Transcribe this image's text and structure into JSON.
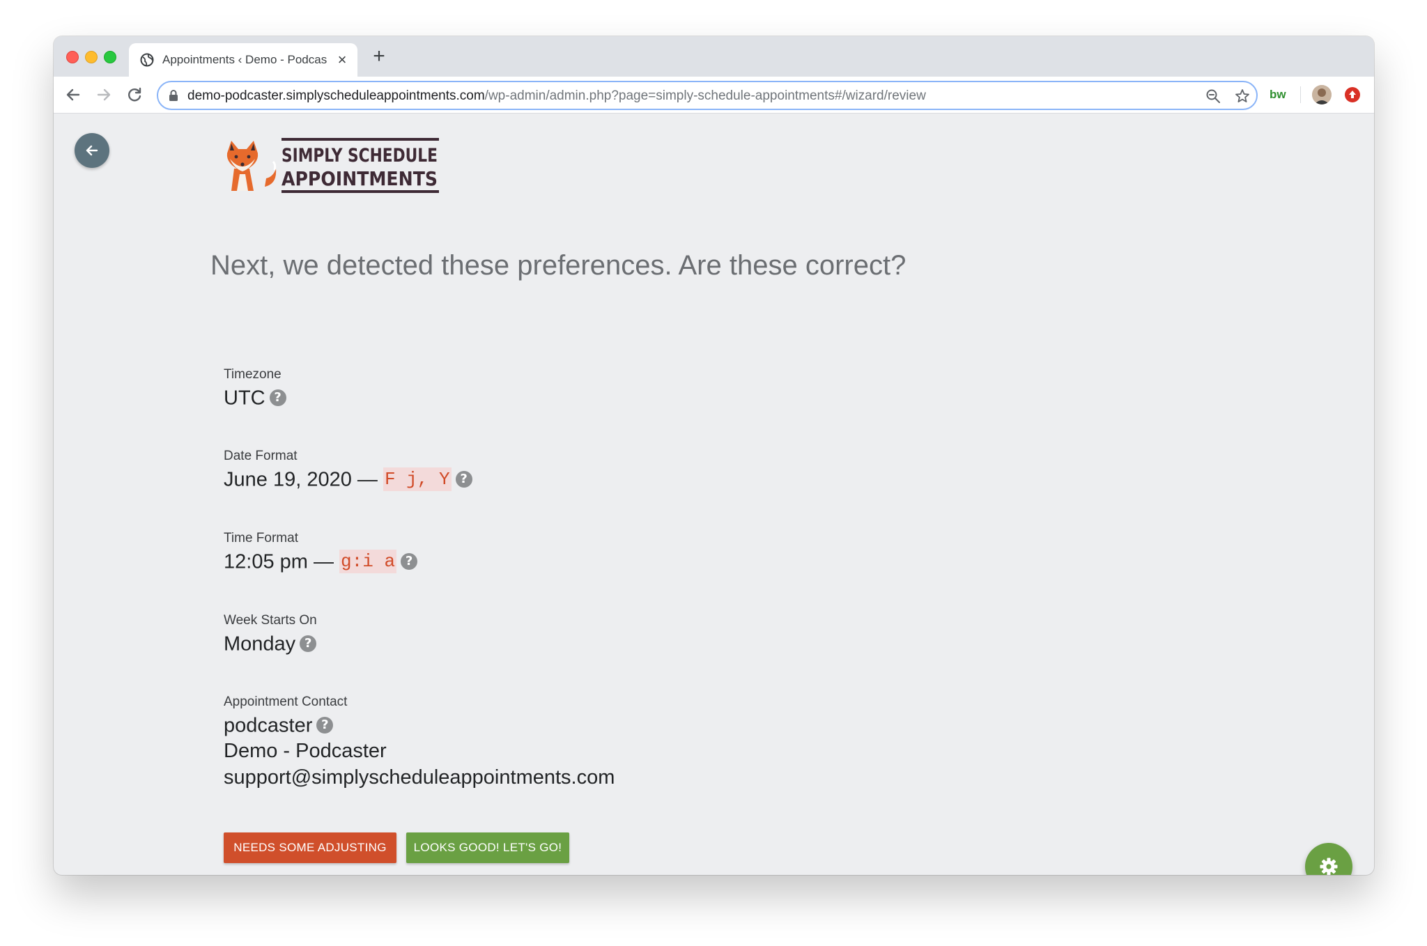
{
  "browser": {
    "tab_title": "Appointments ‹ Demo - Podcaster",
    "url_host": "demo-podcaster.simplyscheduleappointments.com",
    "url_path": "/wp-admin/admin.php?page=simply-schedule-appointments#/wizard/review",
    "extension_label": "bw"
  },
  "logo": {
    "line1": "SIMPLY SCHEDULE",
    "line2": "APPOINTMENTS"
  },
  "page": {
    "headline": "Next, we detected these preferences. Are these correct?"
  },
  "fields": {
    "timezone": {
      "label": "Timezone",
      "value": "UTC"
    },
    "date_format": {
      "label": "Date Format",
      "value": "June 19, 2020 —",
      "code": "F j, Y"
    },
    "time_format": {
      "label": "Time Format",
      "value": "12:05 pm —",
      "code": "g:i a"
    },
    "week_start": {
      "label": "Week Starts On",
      "value": "Monday"
    },
    "contact": {
      "label": "Appointment Contact",
      "username": "podcaster",
      "name": "Demo - Podcaster",
      "email": "support@simplyscheduleappointments.com"
    }
  },
  "buttons": {
    "adjust_label": "NEEDS SOME ADJUSTING",
    "confirm_label": "LOOKS GOOD! LET'S GO!"
  },
  "help_glyph": "?",
  "colors": {
    "adjust_button": "#d04f2b",
    "confirm_button": "#6aa043",
    "code_text": "#d14b28",
    "back_button": "#5d737e"
  },
  "icons": [
    "globe-icon",
    "close-icon",
    "plus-icon",
    "back-arrow-icon",
    "forward-arrow-icon",
    "reload-icon",
    "lock-icon",
    "zoom-icon",
    "star-icon",
    "help-icon",
    "gear-icon",
    "fox-logo-icon"
  ]
}
